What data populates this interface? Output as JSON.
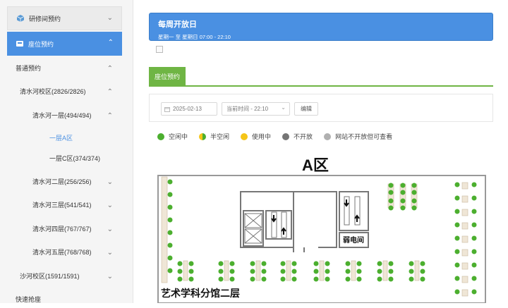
{
  "sidebar": {
    "group1": {
      "label": "研修间预约",
      "icon": "cube-icon"
    },
    "group2": {
      "label": "座位预约",
      "icon": "seat-icon"
    },
    "items": [
      {
        "label": "普通预约"
      },
      {
        "label": "清水河校区(2826/2826)"
      },
      {
        "label": "清水河一层(494/494)"
      },
      {
        "label": "一层A区"
      },
      {
        "label": "一层C区(374/374)"
      },
      {
        "label": "清水河二层(256/256)"
      },
      {
        "label": "清水河三层(541/541)"
      },
      {
        "label": "清水河四层(767/767)"
      },
      {
        "label": "清水河五层(768/768)"
      },
      {
        "label": "沙河校区(1591/1591)"
      },
      {
        "label": "快速抢座"
      }
    ]
  },
  "header": {
    "title": "每周开放日",
    "subtitle": "星期一 至 星期日  07:00 - 22:10"
  },
  "tab": {
    "label": "座位预约"
  },
  "filters": {
    "date": "2025-02-13",
    "time": "当前时间 - 22:10",
    "edit_label": "编辑"
  },
  "legend": [
    {
      "label": "空闲中",
      "color": "#4caf2f"
    },
    {
      "label": "半空闲",
      "color": "#8bc34a"
    },
    {
      "label": "使用中",
      "color": "#f5c518"
    },
    {
      "label": "不开放",
      "color": "#757575"
    },
    {
      "label": "网站不开放但可查看",
      "color": "#b0b0b0"
    }
  ],
  "map": {
    "area_title": "A区",
    "floor_label": "艺术学科分馆二层",
    "room_label": "弱电间"
  }
}
